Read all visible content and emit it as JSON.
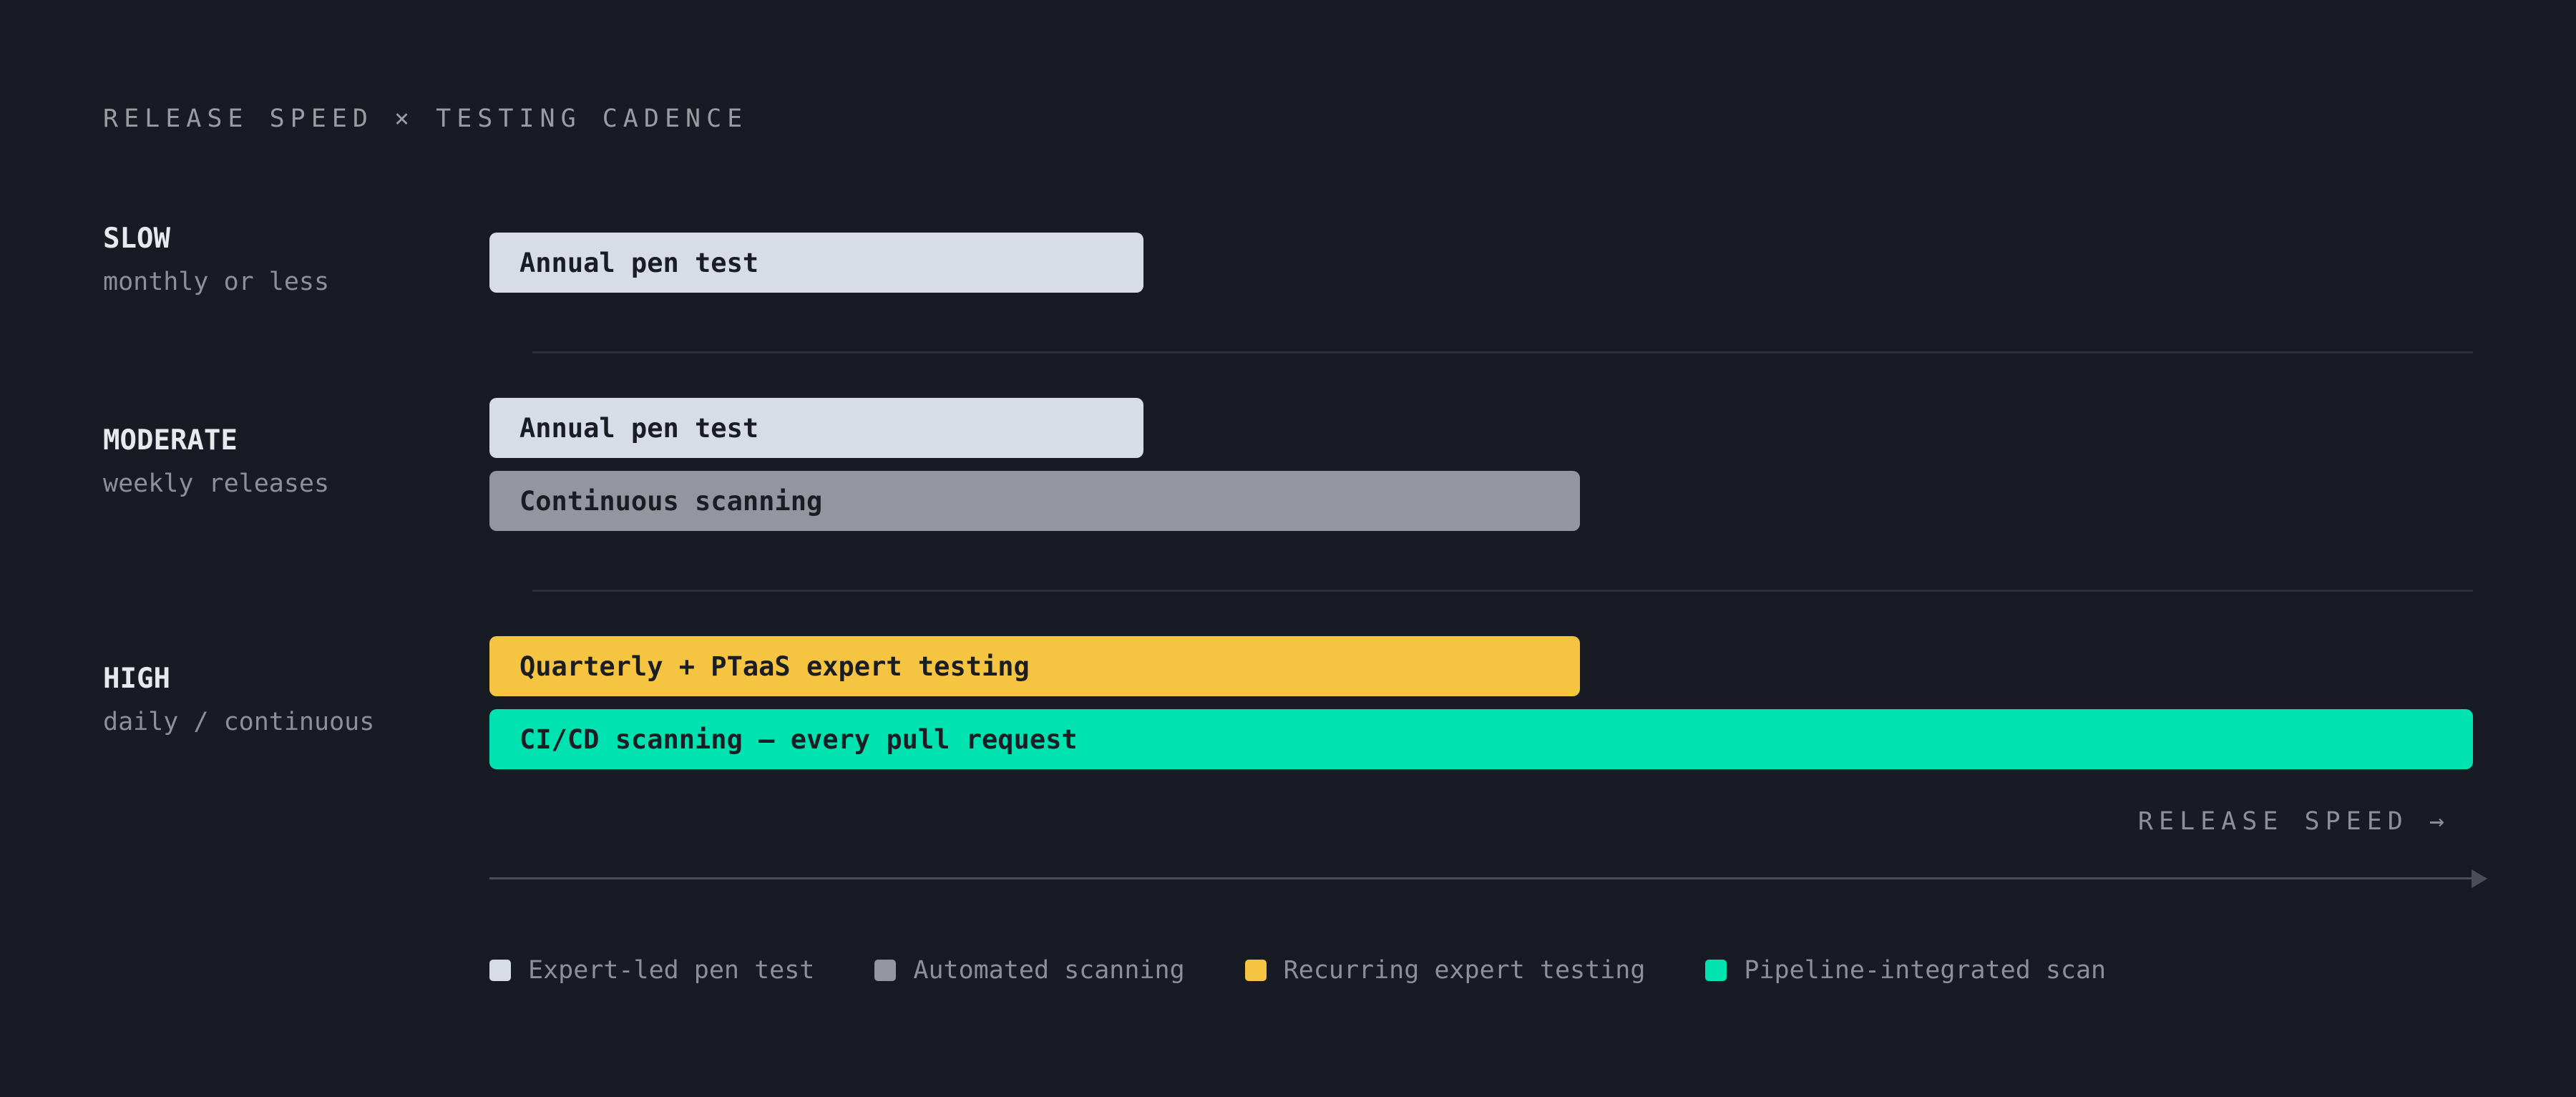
{
  "title": "RELEASE SPEED × TESTING CADENCE",
  "colors": {
    "expert_pen_test": "#d8dce7",
    "automated_scanning": "#93969f",
    "recurring_expert": "#f5c542",
    "pipeline_scan": "#00e3b1",
    "background": "#181b23"
  },
  "rows": [
    {
      "name": "SLOW",
      "sub": "monthly or less",
      "bars": [
        {
          "label": "Annual pen test",
          "category": "expert_pen_test"
        }
      ]
    },
    {
      "name": "MODERATE",
      "sub": "weekly releases",
      "bars": [
        {
          "label": "Annual pen test",
          "category": "expert_pen_test"
        },
        {
          "label": "Continuous scanning",
          "category": "automated_scanning"
        }
      ]
    },
    {
      "name": "HIGH",
      "sub": "daily / continuous",
      "bars": [
        {
          "label": "Quarterly + PTaaS expert testing",
          "category": "recurring_expert"
        },
        {
          "label": "CI/CD scanning — every pull request",
          "category": "pipeline_scan"
        }
      ]
    }
  ],
  "axis_label": "RELEASE SPEED →",
  "legend": [
    {
      "label": "Expert-led pen test",
      "category": "expert_pen_test"
    },
    {
      "label": "Automated scanning",
      "category": "automated_scanning"
    },
    {
      "label": "Recurring expert testing",
      "category": "recurring_expert"
    },
    {
      "label": "Pipeline-integrated scan",
      "category": "pipeline_scan"
    }
  ]
}
